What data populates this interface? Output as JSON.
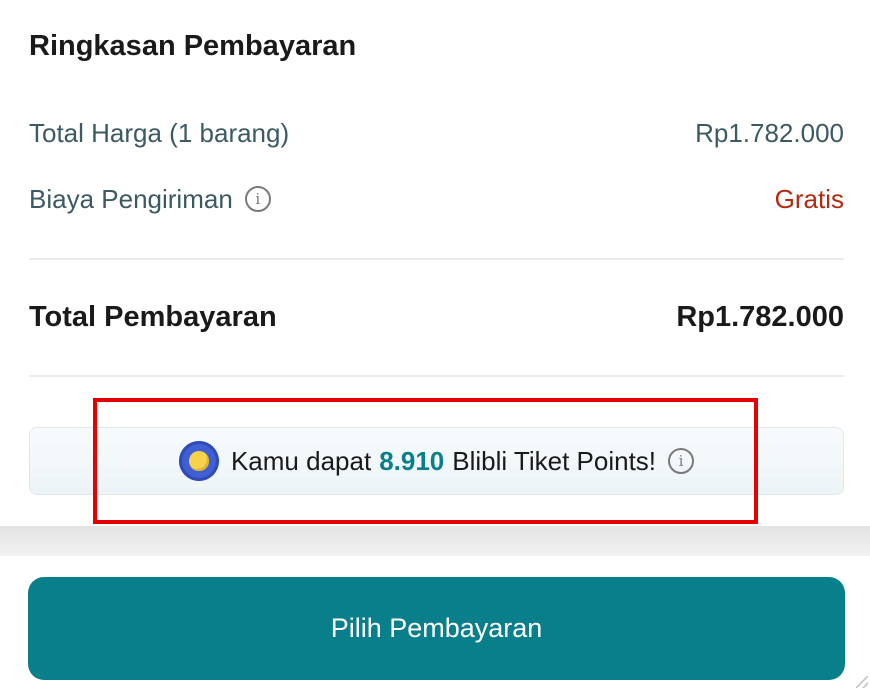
{
  "summary": {
    "title": "Ringkasan Pembayaran",
    "price_label": "Total Harga (1 barang)",
    "price_value": "Rp1.782.000",
    "shipping_label": "Biaya Pengiriman",
    "shipping_value": "Gratis",
    "total_label": "Total Pembayaran",
    "total_value": "Rp1.782.000"
  },
  "points": {
    "prefix": "Kamu dapat",
    "amount": "8.910",
    "suffix": "Blibli Tiket Points!",
    "icon": "coin-icon",
    "info_icon": "info-icon"
  },
  "footer": {
    "pay_button_label": "Pilih Pembayaran"
  },
  "colors": {
    "accent": "#0a7f8c",
    "free_text": "#b22a10",
    "highlight": "#e60000"
  }
}
